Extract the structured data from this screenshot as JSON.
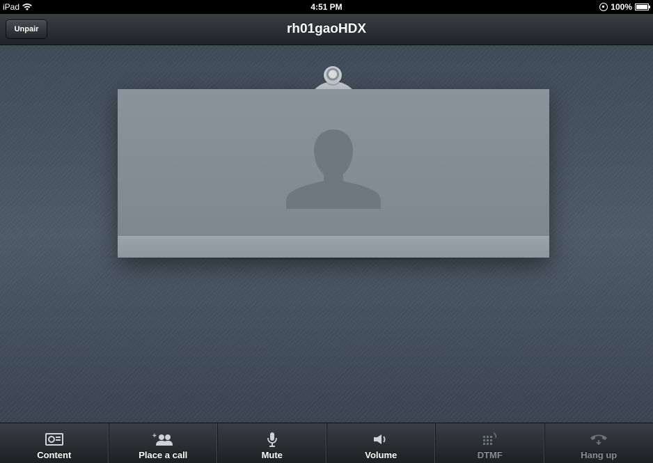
{
  "status_bar": {
    "device": "iPad",
    "time": "4:51 PM",
    "battery": "100%"
  },
  "nav": {
    "unpair_label": "Unpair",
    "title": "rh01gaoHDX"
  },
  "toolbar": {
    "items": [
      {
        "label": "Content",
        "icon": "content-icon",
        "enabled": true
      },
      {
        "label": "Place a call",
        "icon": "add-contacts-icon",
        "enabled": true
      },
      {
        "label": "Mute",
        "icon": "microphone-icon",
        "enabled": true
      },
      {
        "label": "Volume",
        "icon": "speaker-icon",
        "enabled": true
      },
      {
        "label": "DTMF",
        "icon": "keypad-icon",
        "enabled": false
      },
      {
        "label": "Hang up",
        "icon": "hang-up-icon",
        "enabled": false
      }
    ]
  },
  "colors": {
    "main_background": "#4a5562",
    "screen": "#868e96",
    "toolbar": "#2a2d31"
  }
}
